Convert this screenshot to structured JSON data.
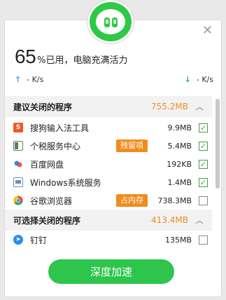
{
  "header": {
    "usage_percent": "65",
    "usage_percent_sign": "%",
    "usage_text": "已用，电脑充满活力",
    "upload_speed": "- K/s",
    "download_speed": "- K/s"
  },
  "sections": {
    "recommended": {
      "title": "建议关闭的程序",
      "size": "755.2MB"
    },
    "optional": {
      "title": "可选择关闭的程序",
      "size": "413.4MB"
    }
  },
  "apps": [
    {
      "name": "搜狗输入法工具",
      "size": "9.9MB",
      "tag": "",
      "checked": true,
      "icon": "sogou-icon"
    },
    {
      "name": "个税服务中心",
      "size": "5.4MB",
      "tag": "残留项",
      "checked": true,
      "icon": "tax-icon"
    },
    {
      "name": "百度网盘",
      "size": "192KB",
      "tag": "",
      "checked": true,
      "icon": "baidu-netdisk-icon"
    },
    {
      "name": "Windows系统服务",
      "size": "1.4MB",
      "tag": "",
      "checked": true,
      "icon": "windows-icon"
    },
    {
      "name": "谷歌浏览器",
      "size": "738.3MB",
      "tag": "占内存",
      "checked": false,
      "icon": "chrome-icon"
    },
    {
      "name": "钉钉",
      "size": "135MB",
      "tag": "",
      "checked": false,
      "icon": "dingtalk-icon"
    }
  ],
  "action": {
    "label": "深度加速"
  },
  "colors": {
    "accent": "#2dc54c",
    "warning": "#f08c1e",
    "upload": "#3aa0e8"
  }
}
